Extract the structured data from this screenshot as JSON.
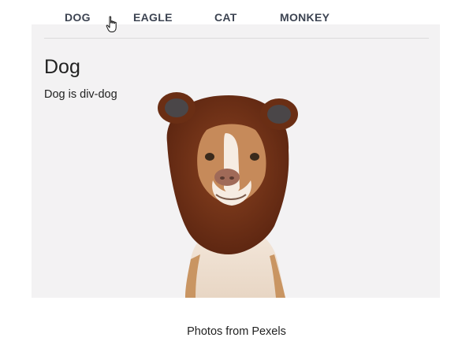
{
  "tabs": [
    {
      "label": "DOG"
    },
    {
      "label": "EAGLE"
    },
    {
      "label": "CAT"
    },
    {
      "label": "MONKEY"
    }
  ],
  "panel": {
    "title": "Dog",
    "text": "Dog is div-dog",
    "image_icon": "dog-in-bear-hat-photo"
  },
  "footer": {
    "text": "Photos from Pexels"
  },
  "cursor": {
    "icon": "hand-pointer-icon"
  },
  "colors": {
    "tab_text": "#3d4452",
    "panel_bg": "#f3f2f3",
    "text": "#222222"
  }
}
